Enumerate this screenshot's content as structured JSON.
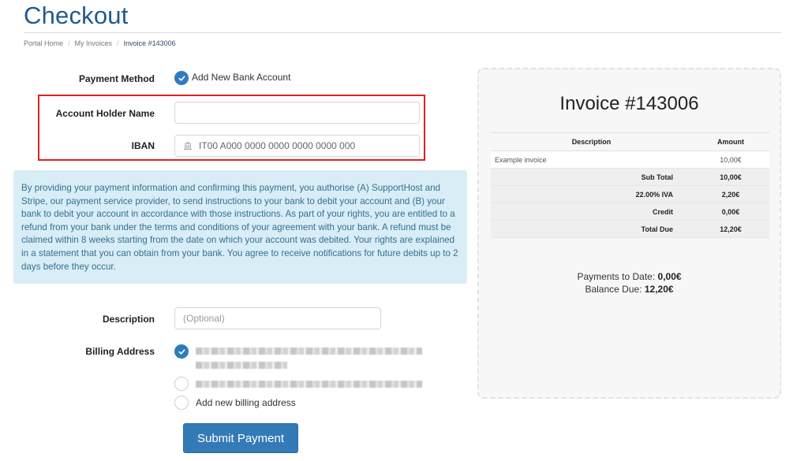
{
  "page": {
    "title": "Checkout"
  },
  "breadcrumb": [
    {
      "label": "Portal Home"
    },
    {
      "label": "My Invoices"
    },
    {
      "label": "Invoice #143006"
    }
  ],
  "breadcrumb_separator": "/",
  "form": {
    "payment_method": {
      "label": "Payment Method",
      "option": "Add New Bank Account",
      "selected": true
    },
    "account_holder_name": {
      "label": "Account Holder Name",
      "value": "",
      "placeholder": ""
    },
    "iban": {
      "label": "IBAN",
      "value": "",
      "placeholder": "IT00 A000 0000 0000 0000 0000 000",
      "icon": "bank-icon"
    },
    "mandate_text": "By providing your payment information and confirming this payment, you authorise (A) SupportHost and Stripe, our payment service provider, to send instructions to your bank to debit your account and (B) your bank to debit your account in accordance with those instructions. As part of your rights, you are entitled to a refund from your bank under the terms and conditions of your agreement with your bank. A refund must be claimed within 8 weeks starting from the date on which your account was debited. Your rights are explained in a statement that you can obtain from your bank. You agree to receive notifications for future debits up to 2 days before they occur.",
    "description": {
      "label": "Description",
      "value": "",
      "placeholder": "(Optional)"
    },
    "billing_address": {
      "label": "Billing Address",
      "options": [
        {
          "label": "[redacted address]",
          "selected": true,
          "redacted": true
        },
        {
          "label": "[redacted address]",
          "selected": false,
          "redacted": true
        },
        {
          "label": "Add new billing address",
          "selected": false,
          "redacted": false
        }
      ]
    },
    "submit_label": "Submit Payment"
  },
  "invoice": {
    "title": "Invoice #143006",
    "columns": [
      "Description",
      "Amount"
    ],
    "items": [
      {
        "description": "Example invoice",
        "amount": "10,00€"
      }
    ],
    "totals": [
      {
        "label": "Sub Total",
        "amount": "10,00€"
      },
      {
        "label": "22.00% IVA",
        "amount": "2,20€"
      },
      {
        "label": "Credit",
        "amount": "0,00€"
      },
      {
        "label": "Total Due",
        "amount": "12,20€"
      }
    ],
    "payments_to_date_label": "Payments to Date:",
    "payments_to_date": "0,00€",
    "balance_due_label": "Balance Due:",
    "balance_due": "12,20€"
  },
  "colors": {
    "brand": "#1f5a8f",
    "primary": "#337ab7",
    "highlight": "#e02020",
    "info_bg": "#d9edf7",
    "info_text": "#31708f"
  }
}
